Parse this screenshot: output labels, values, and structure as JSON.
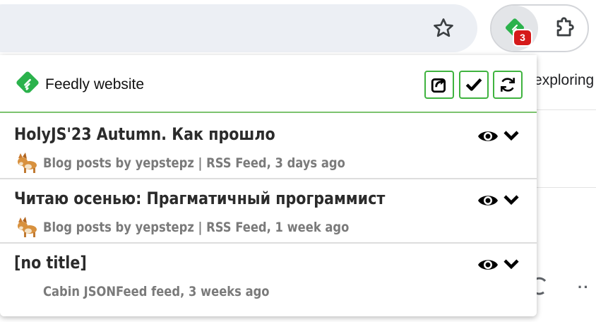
{
  "browser": {
    "extension_badge_count": "3",
    "background_text": "'exploring"
  },
  "popup": {
    "site_link_label": "Feedly website",
    "actions": [
      "open-all",
      "mark-all-read",
      "refresh"
    ],
    "items": [
      {
        "title": "HolyJS'23 Autumn. Как прошло",
        "meta": "Blog posts by yepstepz | RSS Feed, 3 days ago",
        "has_avatar": true
      },
      {
        "title": "Читаю осенью: Прагматичный программист",
        "meta": "Blog posts by yepstepz | RSS Feed, 1 week ago",
        "has_avatar": true
      },
      {
        "title": "[no title]",
        "meta": "Cabin JSONFeed feed, 3 weeks ago",
        "has_avatar": false
      }
    ]
  },
  "colors": {
    "feedly_green": "#2bb24c",
    "button_border": "#3fb33f",
    "badge_red": "#d51a1a"
  },
  "icons": [
    "star-icon",
    "feedly-icon",
    "puzzle-icon",
    "share-icon",
    "checkmark-icon",
    "refresh-icon",
    "eye-icon",
    "chevron-down-icon",
    "dog-avatar-icon"
  ]
}
